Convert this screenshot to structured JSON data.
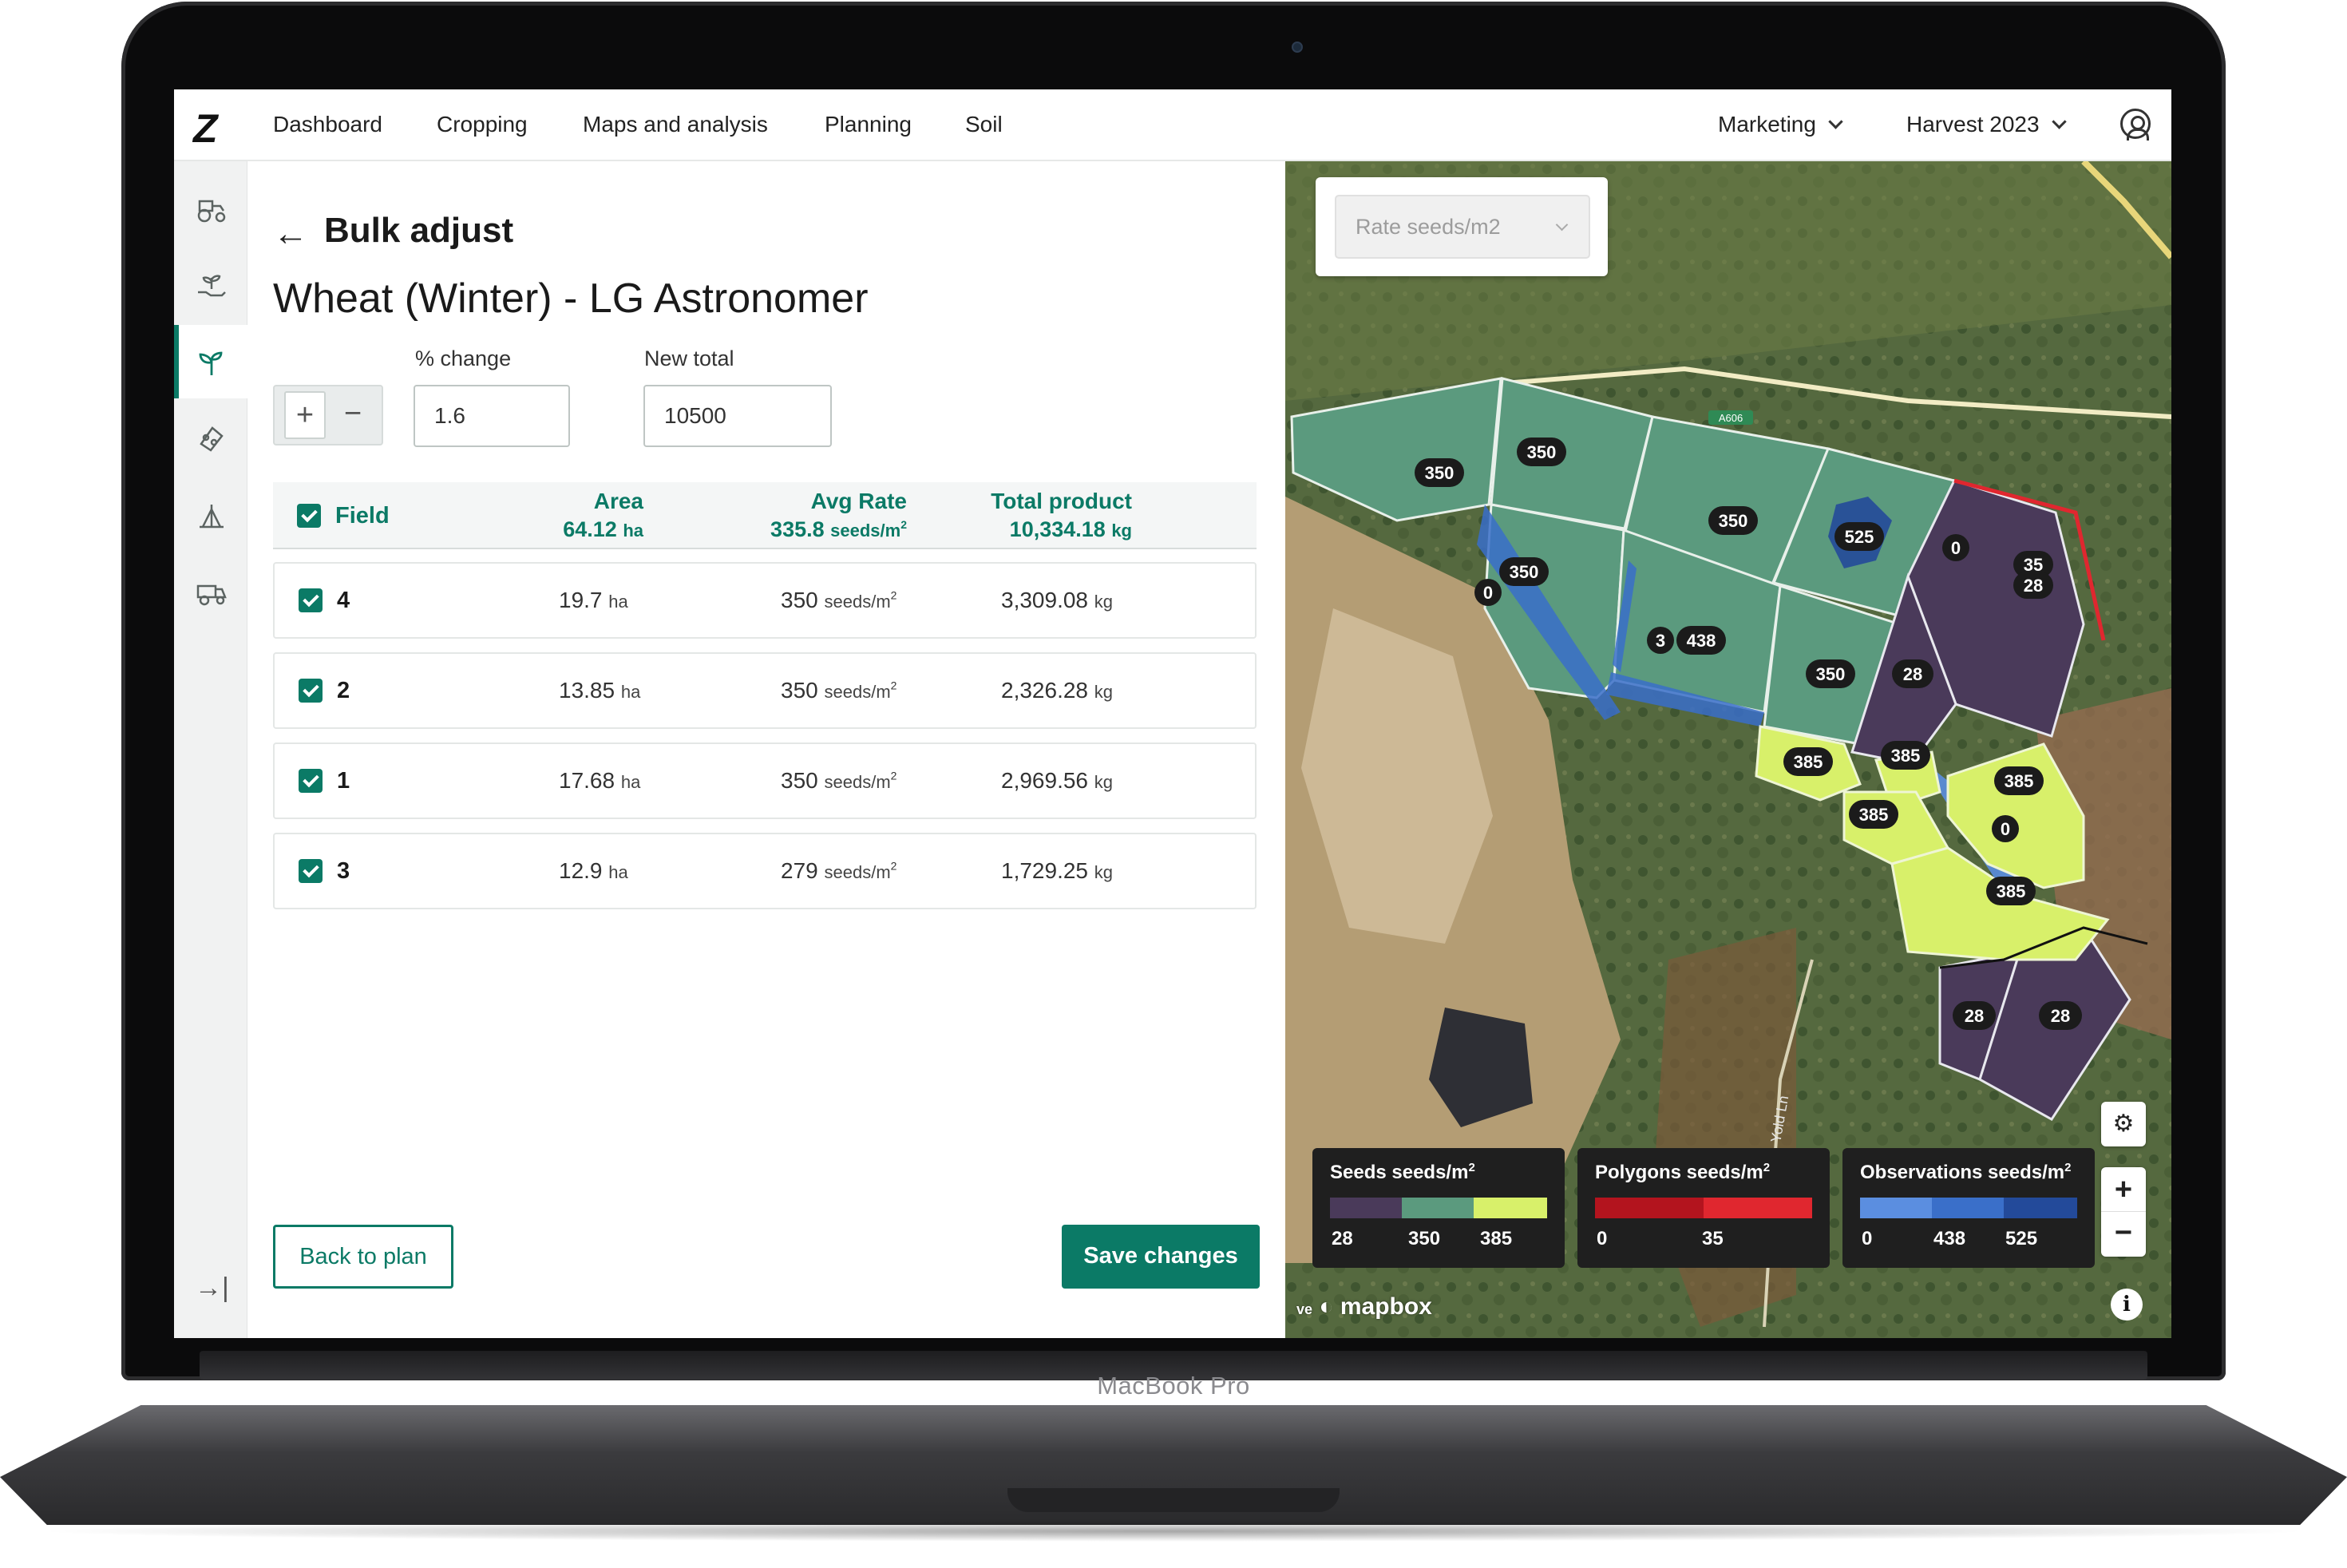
{
  "device": {
    "model_label": "MacBook Pro"
  },
  "nav": {
    "logo": "Z",
    "items": [
      "Dashboard",
      "Cropping",
      "Maps and analysis",
      "Planning",
      "Soil"
    ],
    "org_selector": "Marketing",
    "season_selector": "Harvest 2023"
  },
  "sidebar": {
    "icons": [
      "tractor-icon",
      "hand-seedling-icon",
      "sprout-icon",
      "fertiliser-icon",
      "spray-icon",
      "harvester-icon"
    ],
    "active_index": 2,
    "collapse_icon": "collapse-icon"
  },
  "panel": {
    "title": "Bulk adjust",
    "crop": "Wheat (Winter) - LG Astronomer",
    "pct_label": "% change",
    "total_label": "New total",
    "pct_value": "1.6",
    "total_value": "10500",
    "plus": "+",
    "minus": "−",
    "table": {
      "headers": {
        "field": "Field",
        "area": "Area",
        "avg_rate": "Avg Rate",
        "total_product": "Total product",
        "area_total": "64.12",
        "area_unit": "ha",
        "avg_rate_total": "335.8",
        "rate_unit": "seeds/m",
        "total_product_total": "10,334.18",
        "product_unit": "kg"
      },
      "rows": [
        {
          "field": "4",
          "area": "19.7",
          "rate": "350",
          "total": "3,309.08"
        },
        {
          "field": "2",
          "area": "13.85",
          "rate": "350",
          "total": "2,326.28"
        },
        {
          "field": "1",
          "area": "17.68",
          "rate": "350",
          "total": "2,969.56"
        },
        {
          "field": "3",
          "area": "12.9",
          "rate": "279",
          "total": "1,729.25"
        }
      ]
    },
    "back_button": "Back to plan",
    "save_button": "Save changes"
  },
  "map": {
    "rate_select": "Rate seeds/m2",
    "field_labels": [
      "350",
      "350",
      "350",
      "525",
      "0",
      "35",
      "28",
      "350",
      "0",
      "3",
      "438",
      "350",
      "28",
      "385",
      "385",
      "385",
      "385",
      "0",
      "385",
      "28",
      "28"
    ],
    "road_label": "Yold Ln",
    "road_sign": "A606",
    "legends": [
      {
        "title": "Seeds seeds/m",
        "ticks": [
          "28",
          "350",
          "385"
        ],
        "colors": [
          "#4a3a5a",
          "#5b9a7e",
          "#d8f06a"
        ]
      },
      {
        "title": "Polygons seeds/m",
        "ticks": [
          "0",
          "35"
        ],
        "colors": [
          "#b3141e",
          "#e0272f"
        ]
      },
      {
        "title": "Observations seeds/m",
        "ticks": [
          "0",
          "438",
          "525"
        ],
        "colors": [
          "#5b8ee0",
          "#3a6fc9",
          "#234a9a"
        ]
      }
    ],
    "attribution": "mapbox",
    "attribution_side": "ve",
    "controls": {
      "zoom_in": "+",
      "zoom_out": "−",
      "settings": "settings-icon",
      "info": "i"
    }
  },
  "colors": {
    "brand": "#0b7a66",
    "seed_green": "#5b9a7e",
    "seed_purple": "#4a3a5a",
    "seed_yellow": "#d8f06a",
    "polygon_red": "#e0272f",
    "observation_blue": "#3a6fc9"
  }
}
